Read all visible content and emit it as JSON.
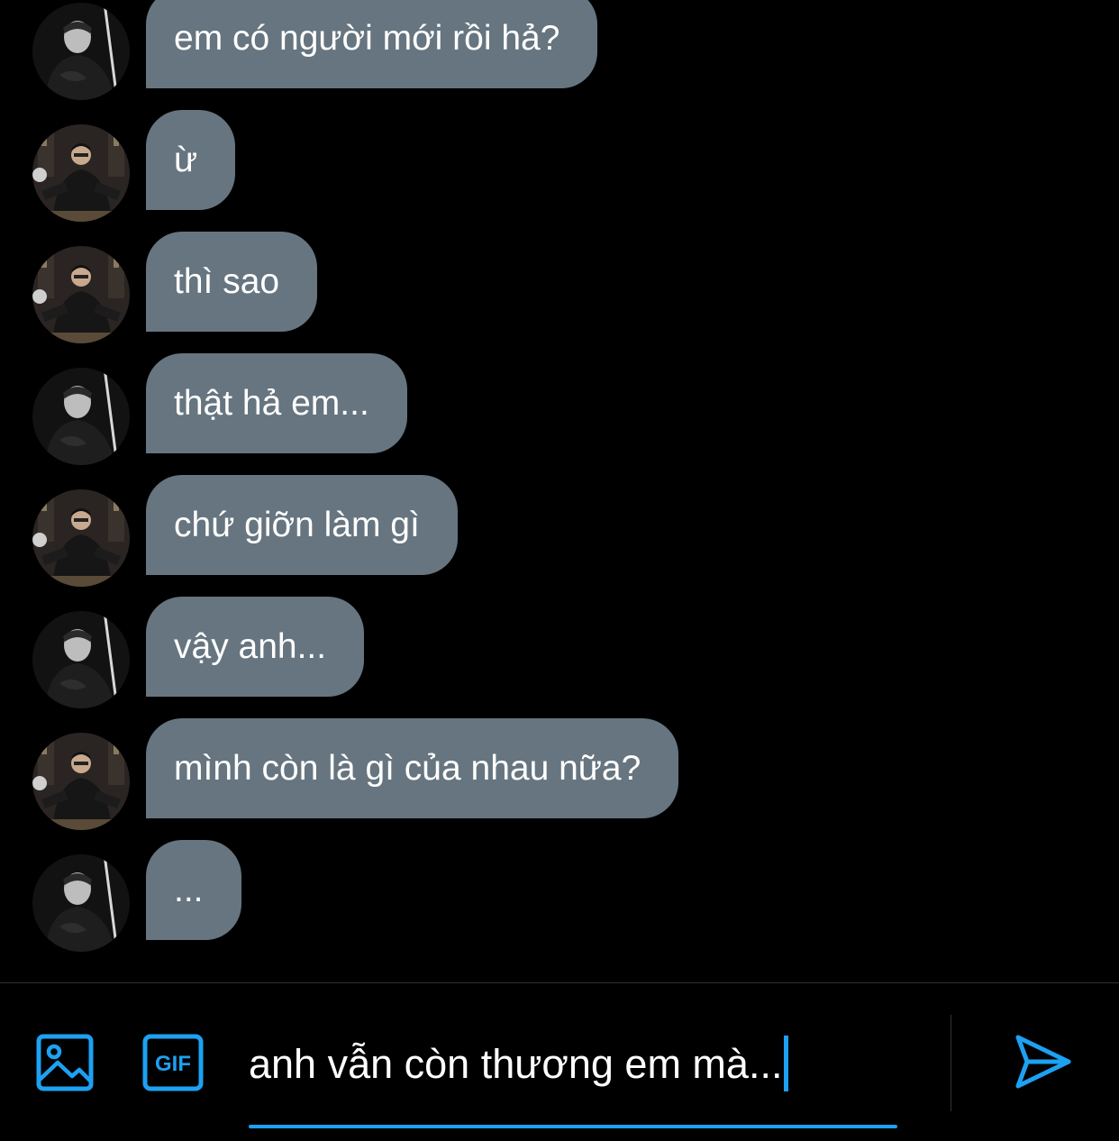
{
  "conversation": {
    "messages": [
      {
        "text": "em có người mới rồi hả?",
        "avatar": "avatar-a"
      },
      {
        "text": "ừ",
        "avatar": "avatar-b"
      },
      {
        "text": "thì sao",
        "avatar": "avatar-b"
      },
      {
        "text": "thật hả em...",
        "avatar": "avatar-a"
      },
      {
        "text": "chứ giỡn làm gì",
        "avatar": "avatar-b"
      },
      {
        "text": "vậy anh...",
        "avatar": "avatar-a"
      },
      {
        "text": "mình còn là gì của nhau nữa?",
        "avatar": "avatar-b"
      },
      {
        "text": "...",
        "avatar": "avatar-a"
      }
    ]
  },
  "composer": {
    "text": "anh vẫn còn thương em mà...",
    "media_icon": "image-icon",
    "gif_icon": "gif-icon",
    "gif_label": "GIF",
    "send_icon": "send-icon"
  },
  "colors": {
    "background": "#000000",
    "bubble": "#66757F",
    "accent": "#1DA1F2",
    "divider": "#2f3336"
  }
}
